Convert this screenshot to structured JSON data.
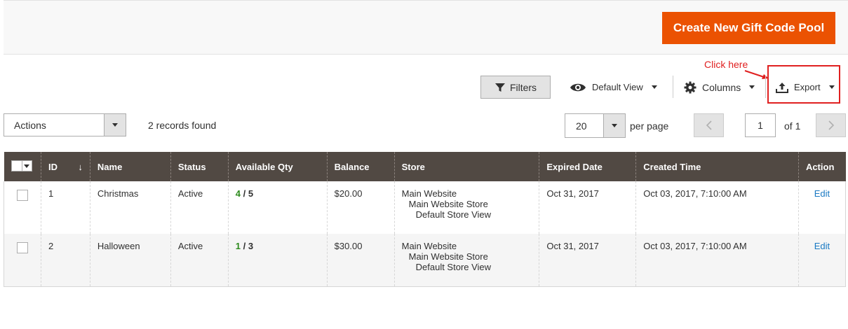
{
  "header": {
    "create_button": "Create New Gift Code Pool"
  },
  "annotation": {
    "text": "Click here"
  },
  "toolbar": {
    "filters": "Filters",
    "default_view": "Default View",
    "columns": "Columns",
    "export": "Export"
  },
  "actions": {
    "label": "Actions"
  },
  "records": {
    "found": "2 records found"
  },
  "pager": {
    "per_page_value": "20",
    "per_page_label": "per page",
    "current_page": "1",
    "of_label": "of 1"
  },
  "table": {
    "columns": {
      "id": "ID",
      "id_sort": "↓",
      "name": "Name",
      "status": "Status",
      "available_qty": "Available Qty",
      "balance": "Balance",
      "store": "Store",
      "expired_date": "Expired Date",
      "created_time": "Created Time",
      "action": "Action"
    },
    "rows": [
      {
        "id": "1",
        "name": "Christmas",
        "status": "Active",
        "qty_available": "4",
        "qty_sep": " / ",
        "qty_total": "5",
        "balance": "$20.00",
        "store_website": "Main Website",
        "store_store": "Main Website Store",
        "store_view": "Default Store View",
        "expired_date": "Oct 31, 2017",
        "created_time": "Oct 03, 2017, 7:10:00 AM",
        "action": "Edit"
      },
      {
        "id": "2",
        "name": "Halloween",
        "status": "Active",
        "qty_available": "1",
        "qty_sep": " / ",
        "qty_total": "3",
        "balance": "$30.00",
        "store_website": "Main Website",
        "store_store": "Main Website Store",
        "store_view": "Default Store View",
        "expired_date": "Oct 31, 2017",
        "created_time": "Oct 03, 2017, 7:10:00 AM",
        "action": "Edit"
      }
    ]
  },
  "colors": {
    "primary": "#eb5202",
    "header_bg": "#514943",
    "link": "#1979c3",
    "qty_green": "#2e8b1e",
    "annotation_red": "#e02020"
  },
  "icons": [
    "filter-icon",
    "eye-icon",
    "gear-icon",
    "export-icon",
    "chevron-left-icon",
    "chevron-right-icon"
  ]
}
